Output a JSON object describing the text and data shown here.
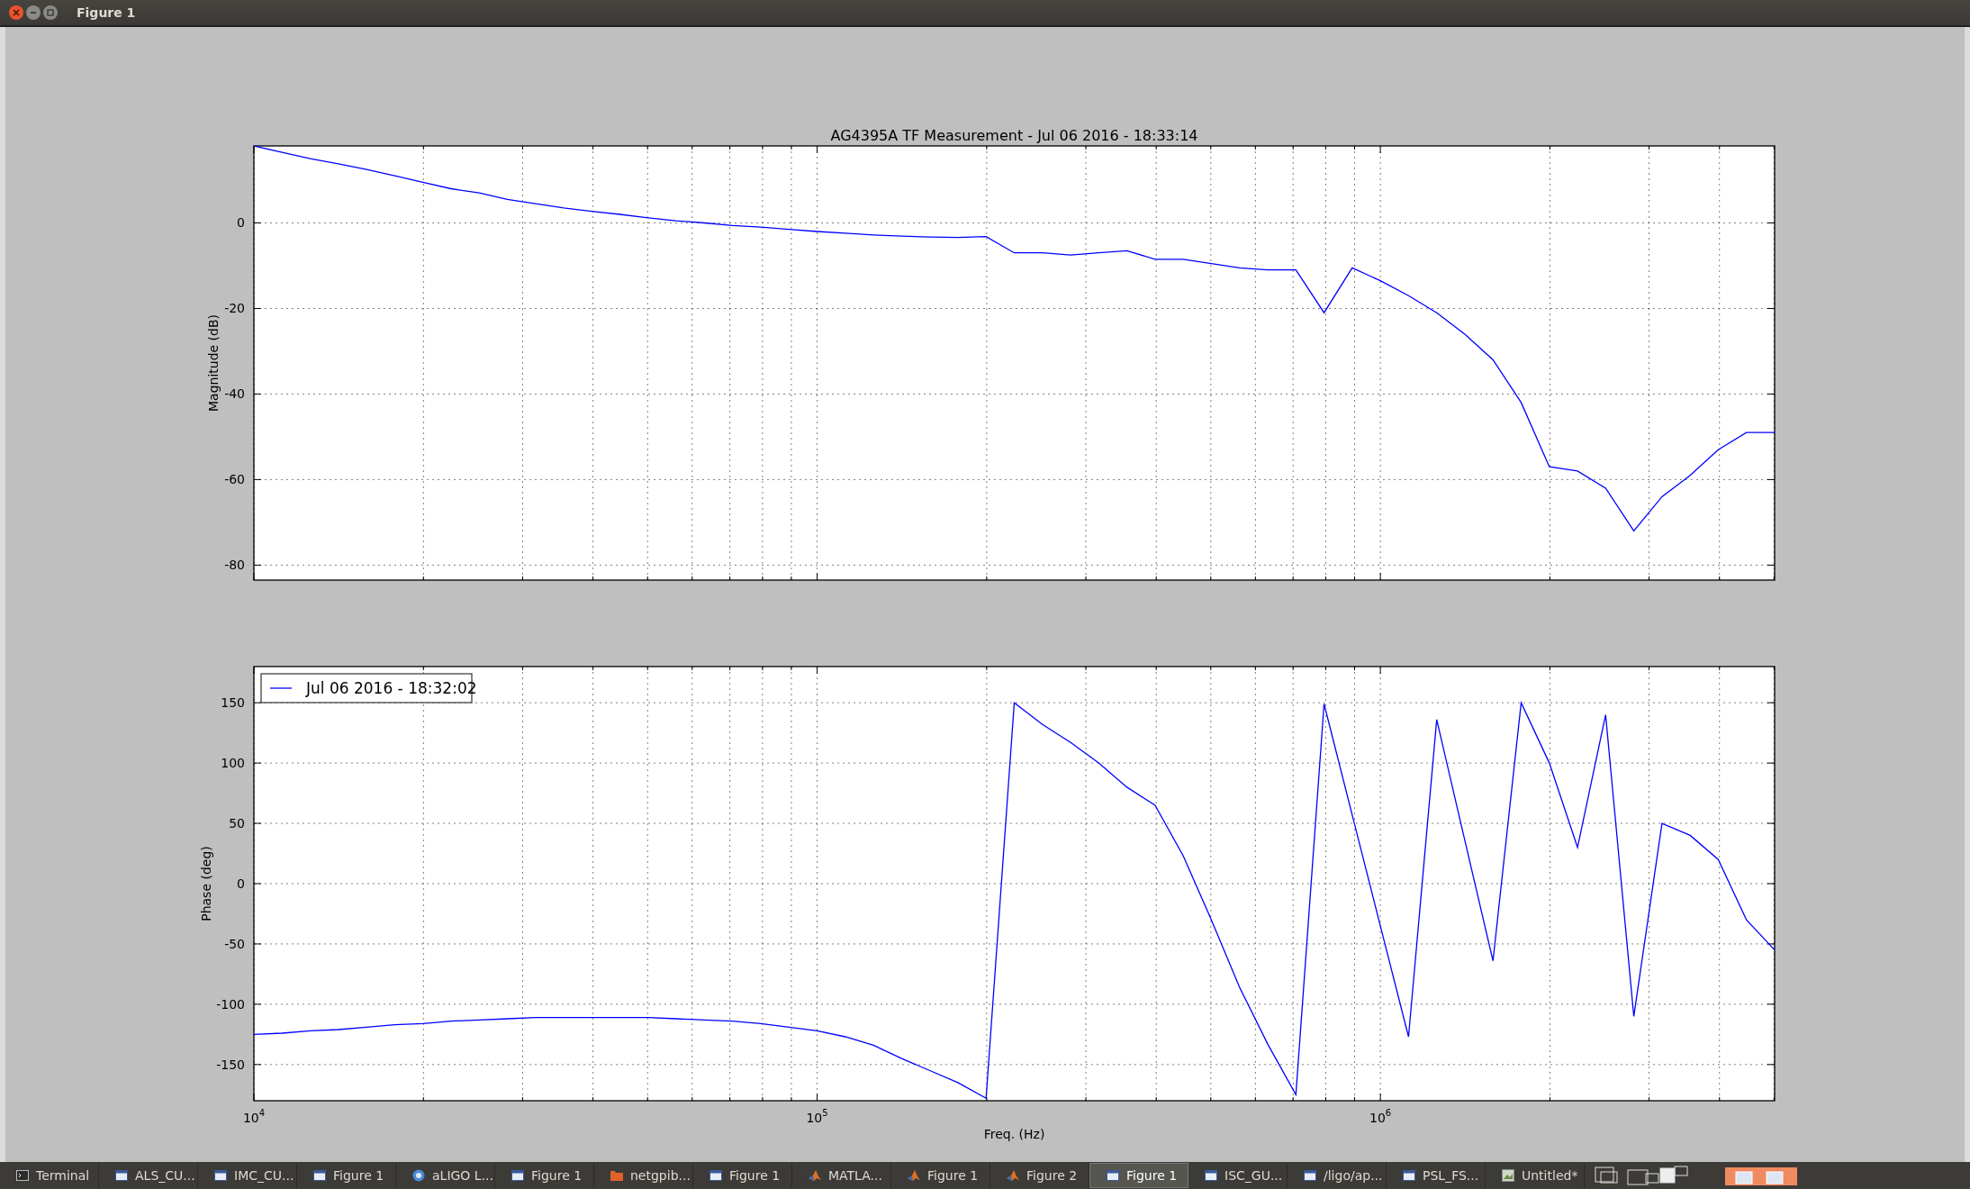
{
  "window": {
    "title": "Figure 1"
  },
  "magnitude_plot": {
    "chart_data": {
      "type": "line",
      "title": "AG4395A TF Measurement - Jul 06 2016 - 18:33:14",
      "ylabel": "Magnitude (dB)",
      "grid": true,
      "ylim": [
        -83.5,
        18
      ],
      "yticks": [
        -80,
        -60,
        -40,
        -20,
        0
      ],
      "categories": [
        null,
        null,
        null,
        null,
        null,
        null,
        null,
        null,
        null,
        null,
        null,
        null,
        null,
        null,
        null,
        null,
        null,
        null,
        null,
        null,
        null,
        null,
        null,
        null,
        null,
        null,
        null,
        null,
        null,
        null,
        null,
        null,
        null,
        null,
        null,
        null,
        null,
        null,
        null,
        null,
        null,
        null,
        null,
        null,
        null,
        null,
        null,
        null,
        null,
        null,
        null,
        null,
        null,
        null,
        null
      ],
      "series": [
        {
          "color": "#0000ff",
          "values": [
            18,
            16.5,
            15,
            13.8,
            12.5,
            11,
            9.5,
            8,
            7,
            5.5,
            4.5,
            3.5,
            2.7,
            2,
            1.2,
            0.5,
            0,
            -0.6,
            -1,
            -1.5,
            -2,
            -2.4,
            -2.8,
            -3.1,
            -3.3,
            -3.4,
            -3.2,
            -7,
            -7,
            -7.5,
            -7,
            -6.5,
            -8.5,
            -8.5,
            -9.5,
            -10.5,
            -11,
            -11,
            -21,
            -10.5,
            -13.5,
            -17,
            -21,
            -26,
            -32,
            -42,
            -57,
            -58,
            -62,
            -72,
            -64,
            -59,
            -53,
            -49,
            -49
          ]
        }
      ]
    }
  },
  "phase_plot": {
    "chart_data": {
      "type": "line",
      "xlabel": "Freq. (Hz)",
      "ylabel": "Phase (deg)",
      "grid": true,
      "ylim": [
        -180,
        180
      ],
      "yticks": [
        -150,
        -100,
        -50,
        0,
        50,
        100,
        150
      ],
      "categories": [
        "10$^{4}$",
        null,
        null,
        null,
        null,
        null,
        null,
        null,
        null,
        null,
        null,
        null,
        null,
        null,
        null,
        null,
        null,
        null,
        null,
        null,
        "10$^{5}$",
        null,
        null,
        null,
        null,
        null,
        null,
        null,
        null,
        null,
        null,
        null,
        null,
        null,
        null,
        null,
        null,
        null,
        null,
        null,
        "10$^{6}$",
        null,
        null,
        null,
        null,
        null,
        null,
        null,
        null,
        null,
        null,
        null,
        null,
        null,
        null
      ],
      "series": [
        {
          "name": "Jul 06 2016 - 18:32:02",
          "color": "#0000ff",
          "values": [
            -125,
            -124,
            -122,
            -121,
            -119,
            -117,
            -116,
            -114,
            -113,
            -112,
            -111,
            -111,
            -111,
            -111,
            -111,
            -112,
            -113,
            -114,
            -116,
            -119,
            -122,
            -127,
            -134,
            -145,
            -155,
            -165,
            -178,
            150,
            132,
            117,
            100,
            80,
            65,
            23,
            -30,
            -86,
            -133,
            -175,
            149,
            57,
            -35,
            -127,
            136,
            36,
            -64,
            150,
            100,
            30,
            140,
            -110,
            50,
            40,
            20,
            -30,
            -55
          ]
        }
      ]
    }
  },
  "taskbar": {
    "items": [
      {
        "label": "Terminal",
        "kind": "terminal",
        "selected": false
      },
      {
        "label": "ALS_CU...",
        "kind": "window",
        "selected": false
      },
      {
        "label": "IMC_CU...",
        "kind": "window",
        "selected": false
      },
      {
        "label": "Figure 1",
        "kind": "window",
        "selected": false
      },
      {
        "label": "aLIGO L...",
        "kind": "browser",
        "selected": false
      },
      {
        "label": "Figure 1",
        "kind": "window",
        "selected": false
      },
      {
        "label": "netgpib...",
        "kind": "folder",
        "selected": false
      },
      {
        "label": "Figure 1",
        "kind": "window",
        "selected": false
      },
      {
        "label": "MATLA...",
        "kind": "matlab",
        "selected": false
      },
      {
        "label": "Figure 1",
        "kind": "matlab",
        "selected": false
      },
      {
        "label": "Figure 2",
        "kind": "matlab",
        "selected": false
      },
      {
        "label": "Figure 1",
        "kind": "window",
        "selected": true
      },
      {
        "label": "ISC_GU...",
        "kind": "window",
        "selected": false
      },
      {
        "label": "/ligo/ap...",
        "kind": "window",
        "selected": false
      },
      {
        "label": "PSL_FS...",
        "kind": "window",
        "selected": false
      },
      {
        "label": "Untitled*",
        "kind": "image",
        "selected": false
      }
    ]
  }
}
